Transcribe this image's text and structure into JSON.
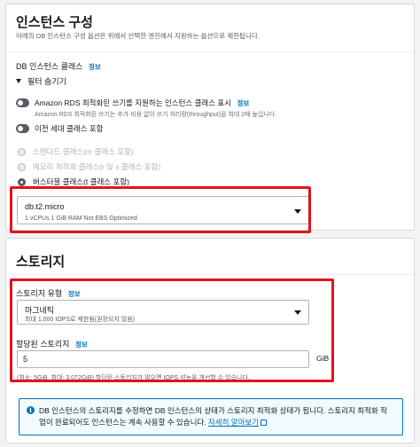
{
  "instance": {
    "title": "인스턴스 구성",
    "description": "아래의 DB 인스턴스 구성 옵션은 위에서 선택한 엔진에서 지원하는 옵션으로 제한됩니다.",
    "class_label": "DB 인스턴스 클래스",
    "info": "정보",
    "filter_toggle": "필터 숨기기",
    "rds_toggle_label": "Amazon RDS 최적화된 쓰기를 지원하는 인스턴스 클래스 표시",
    "rds_toggle_desc": "Amazon RDS 최적화된 쓰기는 추가 비용 없이 쓰기 처리량(throughput)을 최대 2배 높입니다.",
    "prev_gen_label": "이전 세대 클래스 포함",
    "radios": [
      {
        "label": "스탠다드 클래스(m 클래스 포함)",
        "disabled": true,
        "checked": false
      },
      {
        "label": "메모리 최적화 클래스(r 및 x 클래스 포함)",
        "disabled": true,
        "checked": false
      },
      {
        "label": "버스터블 클래스(t 클래스 포함)",
        "disabled": false,
        "checked": true
      }
    ],
    "selected_class": "db.t2.micro",
    "selected_class_detail": "1 vCPUs    1 GiB RAM    Not EBS Optimized"
  },
  "storage": {
    "title": "스토리지",
    "type_label": "스토리지 유형",
    "info": "정보",
    "type_value": "마그네틱",
    "type_detail": "최대 1,000 IOPS로 제한됨(권장되지 않음)",
    "allocated_label": "할당된 스토리지",
    "allocated_value": "5",
    "allocated_unit": "GiB",
    "allocated_hint": "(최소: 5GiB, 최대: 3,072GiB) 할당된 스토리지가 많으면 IOPS 성능을 개선할 수 있습니다.",
    "alert_text": "DB 인스턴스의 스토리지를 수정하면 DB 인스턴스의 상태가 스토리지 최적화 상태가 됩니다. 스토리지 최적화 작업이 완료되어도 인스턴스는 계속 사용할 수 있습니다.",
    "alert_link": "자세히 알아보기"
  },
  "colors": {
    "accent": "#0073bb",
    "highlight_border": "#e0141e",
    "toggle_off": "#545b64"
  }
}
